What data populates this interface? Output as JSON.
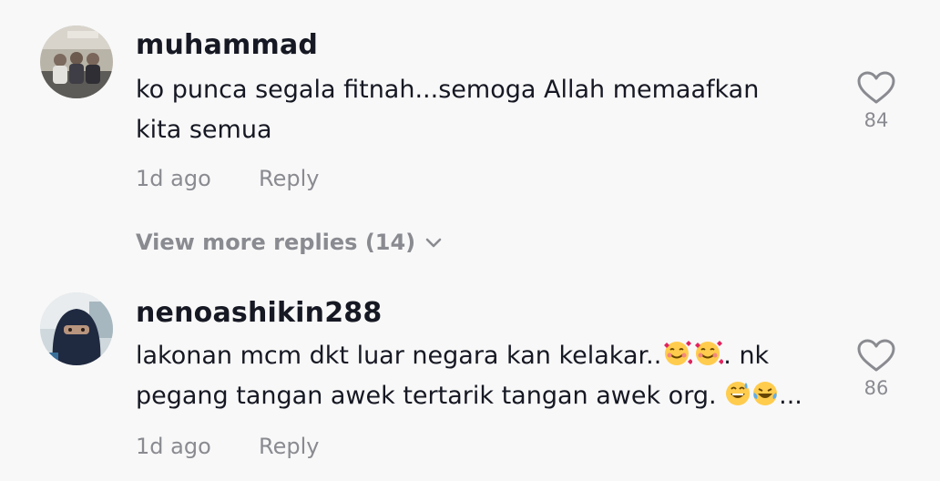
{
  "comments": [
    {
      "username": "muhammad",
      "text_line1": "ko punca segala fitnah...semoga Allah memaafkan",
      "text_line2": "kita semua",
      "time": "1d ago",
      "reply_label": "Reply",
      "likes": "84",
      "avatar_icon": "group-photo-avatar"
    },
    {
      "username": "nenoashikin288",
      "text_line1": "lakonan mcm dkt luar negara kan kelakar..",
      "text_line1_end": ". nk",
      "text_line2": "pegang tangan awek tertarik tangan awek org. ",
      "text_line2_end": "...",
      "time": "1d ago",
      "reply_label": "Reply",
      "likes": "86",
      "avatar_icon": "niqab-selfie-avatar",
      "emojis": [
        "smiling-face-with-hearts",
        "smiling-face-with-hearts",
        "grinning-face-with-sweat",
        "face-with-tears-of-joy"
      ]
    }
  ],
  "view_more": {
    "label": "View more replies (14)",
    "icon": "chevron-down-icon"
  },
  "colors": {
    "background": "#f8f8f8",
    "text_primary": "#161823",
    "text_secondary": "#8a8b91"
  }
}
